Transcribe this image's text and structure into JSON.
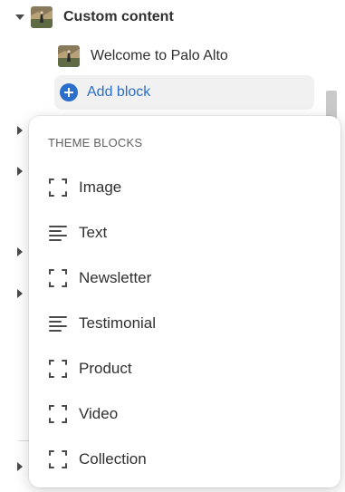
{
  "tree": {
    "section_title": "Custom content",
    "block_label": "Welcome to Palo Alto",
    "add_block_label": "Add block"
  },
  "popover": {
    "heading": "THEME BLOCKS",
    "items": [
      {
        "label": "Image",
        "icon": "frame-icon"
      },
      {
        "label": "Text",
        "icon": "text-lines-icon"
      },
      {
        "label": "Newsletter",
        "icon": "frame-icon"
      },
      {
        "label": "Testimonial",
        "icon": "text-lines-icon"
      },
      {
        "label": "Product",
        "icon": "frame-icon"
      },
      {
        "label": "Video",
        "icon": "frame-icon"
      },
      {
        "label": "Collection",
        "icon": "frame-icon"
      }
    ]
  },
  "colors": {
    "accent": "#2c6ecb",
    "text": "#303030",
    "muted": "#616161"
  }
}
